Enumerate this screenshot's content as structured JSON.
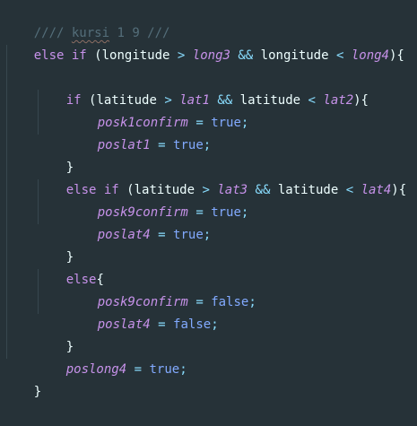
{
  "editor": {
    "theme": {
      "background": "#263238",
      "comment": "#546e7a",
      "keyword": "#c792ea",
      "operator": "#89ddff",
      "boolean": "#82aaff",
      "text": "#eeffff"
    },
    "lines": [
      {
        "comment_prefix": "////",
        "comment_word": "kursi",
        "comment_rest": "1 9 ///"
      },
      {
        "kw": "else if",
        "open": "(",
        "a": "longitude",
        "op1": ">",
        "b": "long3",
        "and": "&&",
        "c": "longitude",
        "op2": "<",
        "d": "long4",
        "close": "){"
      },
      {
        "blank": ""
      },
      {
        "kw": "if",
        "open": "(",
        "a": "latitude",
        "op1": ">",
        "b": "lat1",
        "and": "&&",
        "c": "latitude",
        "op2": "<",
        "d": "lat2",
        "close": "){"
      },
      {
        "name": "posk1confirm",
        "eq": "=",
        "val": "true",
        "semi": ";"
      },
      {
        "name": "poslat1",
        "eq": "=",
        "val": "true",
        "semi": ";"
      },
      {
        "brace": "}"
      },
      {
        "kw": "else if",
        "open": "(",
        "a": "latitude",
        "op1": ">",
        "b": "lat3",
        "and": "&&",
        "c": "latitude",
        "op2": "<",
        "d": "lat4",
        "close": "){"
      },
      {
        "name": "posk9confirm",
        "eq": "=",
        "val": "true",
        "semi": ";"
      },
      {
        "name": "poslat4",
        "eq": "=",
        "val": "true",
        "semi": ";"
      },
      {
        "brace": "}"
      },
      {
        "kw": "else",
        "close": "{"
      },
      {
        "name": "posk9confirm",
        "eq": "=",
        "val": "false",
        "semi": ";"
      },
      {
        "name": "poslat4",
        "eq": "=",
        "val": "false",
        "semi": ";"
      },
      {
        "brace": "}"
      },
      {
        "name": "poslong4",
        "eq": "=",
        "val": "true",
        "semi": ";"
      },
      {
        "brace": "}"
      }
    ]
  }
}
